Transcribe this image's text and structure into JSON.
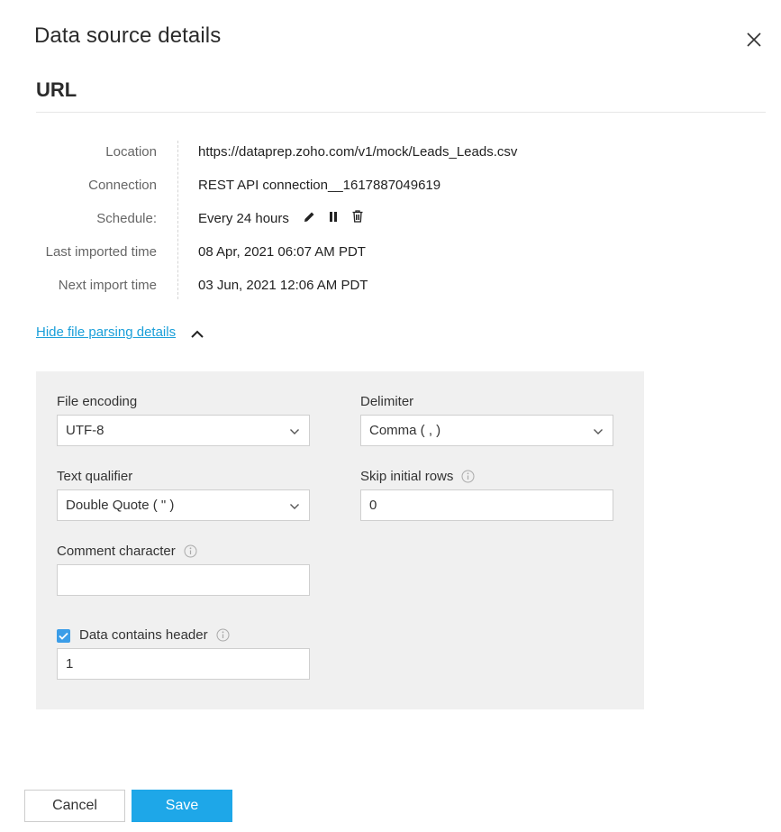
{
  "dialog": {
    "title": "Data source details",
    "close_icon": "close-icon"
  },
  "source": {
    "section_title": "URL",
    "details": [
      {
        "label": "Location",
        "value": "https://dataprep.zoho.com/v1/mock/Leads_Leads.csv"
      },
      {
        "label": "Connection",
        "value": "REST API connection__1617887049619"
      },
      {
        "label": "Schedule:",
        "value": "Every 24 hours"
      },
      {
        "label": "Last imported time",
        "value": "08 Apr, 2021 06:07 AM PDT"
      },
      {
        "label": "Next import time",
        "value": "03 Jun, 2021 12:06 AM PDT"
      }
    ],
    "schedule_icons": [
      "edit-icon",
      "pause-icon",
      "delete-icon"
    ]
  },
  "parsing": {
    "toggle_label": "Hide file parsing details",
    "toggle_icon": "chevron-up-icon",
    "file_encoding": {
      "label": "File encoding",
      "value": "UTF-8"
    },
    "delimiter": {
      "label": "Delimiter",
      "value": "Comma ( , )"
    },
    "text_qualifier": {
      "label": "Text qualifier",
      "value": "Double Quote ( \" )"
    },
    "skip_rows": {
      "label": "Skip initial rows",
      "value": "0"
    },
    "comment_char": {
      "label": "Comment character",
      "value": ""
    },
    "header": {
      "label": "Data contains header",
      "checked": true,
      "value": "1"
    }
  },
  "footer": {
    "cancel_label": "Cancel",
    "save_label": "Save"
  },
  "colors": {
    "accent": "#1ea7e8",
    "link": "#1a9fd9",
    "panel_bg": "#f0f0f0",
    "checkbox": "#3b9de8"
  }
}
